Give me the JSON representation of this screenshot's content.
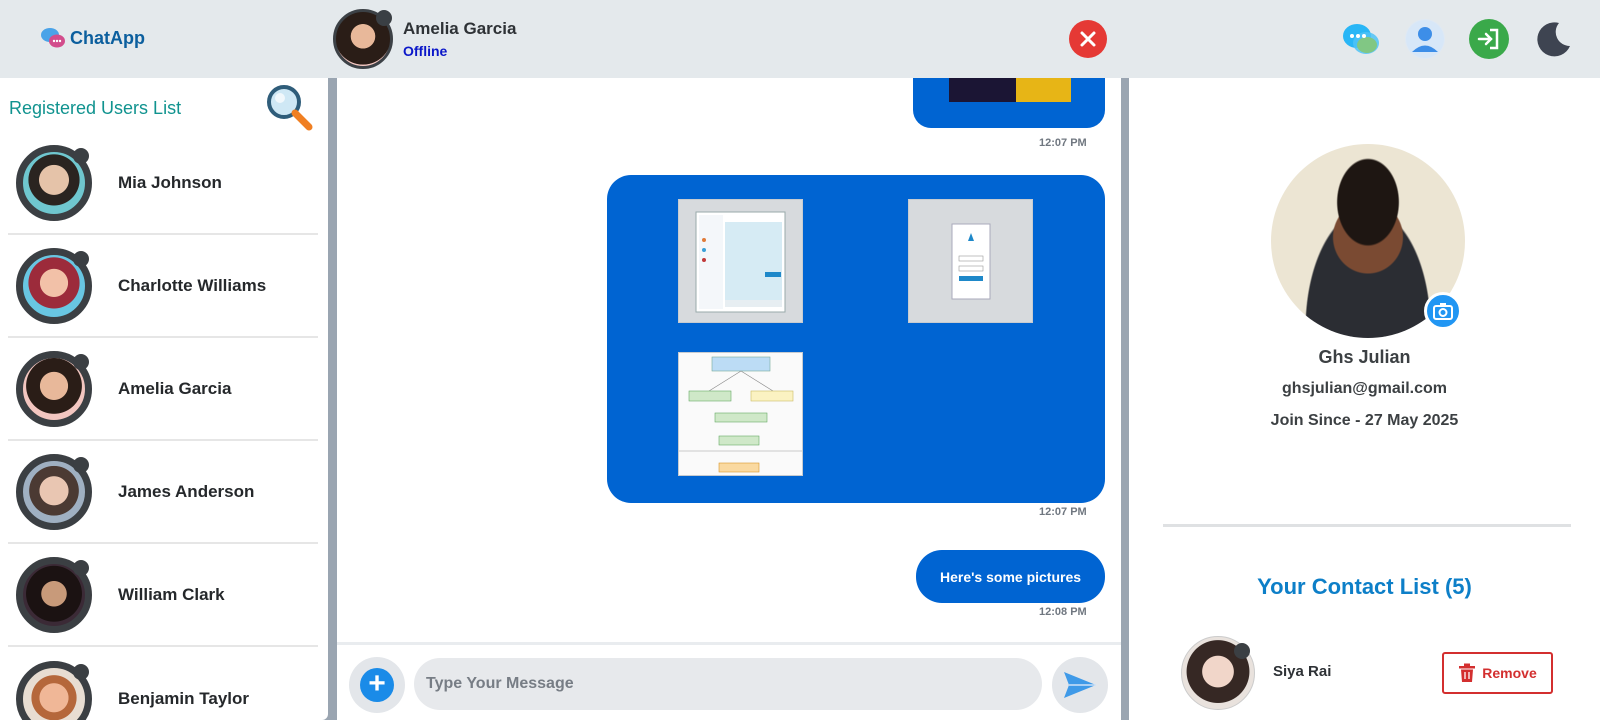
{
  "app": {
    "name": "ChatApp"
  },
  "active_chat": {
    "name": "Amelia Garcia",
    "status": "Offline"
  },
  "header_icons": [
    "chat-icon",
    "profile-icon",
    "logout-icon",
    "dark-mode-icon"
  ],
  "sidebar": {
    "title": "Registered Users List",
    "users": [
      {
        "name": "Mia Johnson"
      },
      {
        "name": "Charlotte Williams"
      },
      {
        "name": "Amelia Garcia"
      },
      {
        "name": "James Anderson"
      },
      {
        "name": "William Clark"
      },
      {
        "name": "Benjamin Taylor"
      }
    ]
  },
  "messages": {
    "time_top": "12:07 PM",
    "time_images": "12:07 PM",
    "text": "Here's some pictures",
    "time_text": "12:08 PM"
  },
  "composer": {
    "placeholder": "Type Your Message"
  },
  "profile": {
    "name": "Ghs Julian",
    "email": "ghsjulian@gmail.com",
    "join": "Join Since - 27 May 2025",
    "contact_list_title": "Your Contact List (5)",
    "contacts": [
      {
        "name": "Siya Rai",
        "action": "Remove"
      }
    ]
  },
  "colors": {
    "accent": "#0064d2",
    "brand": "#0c5f9e",
    "danger": "#d32f2f",
    "teal": "#10938f"
  }
}
